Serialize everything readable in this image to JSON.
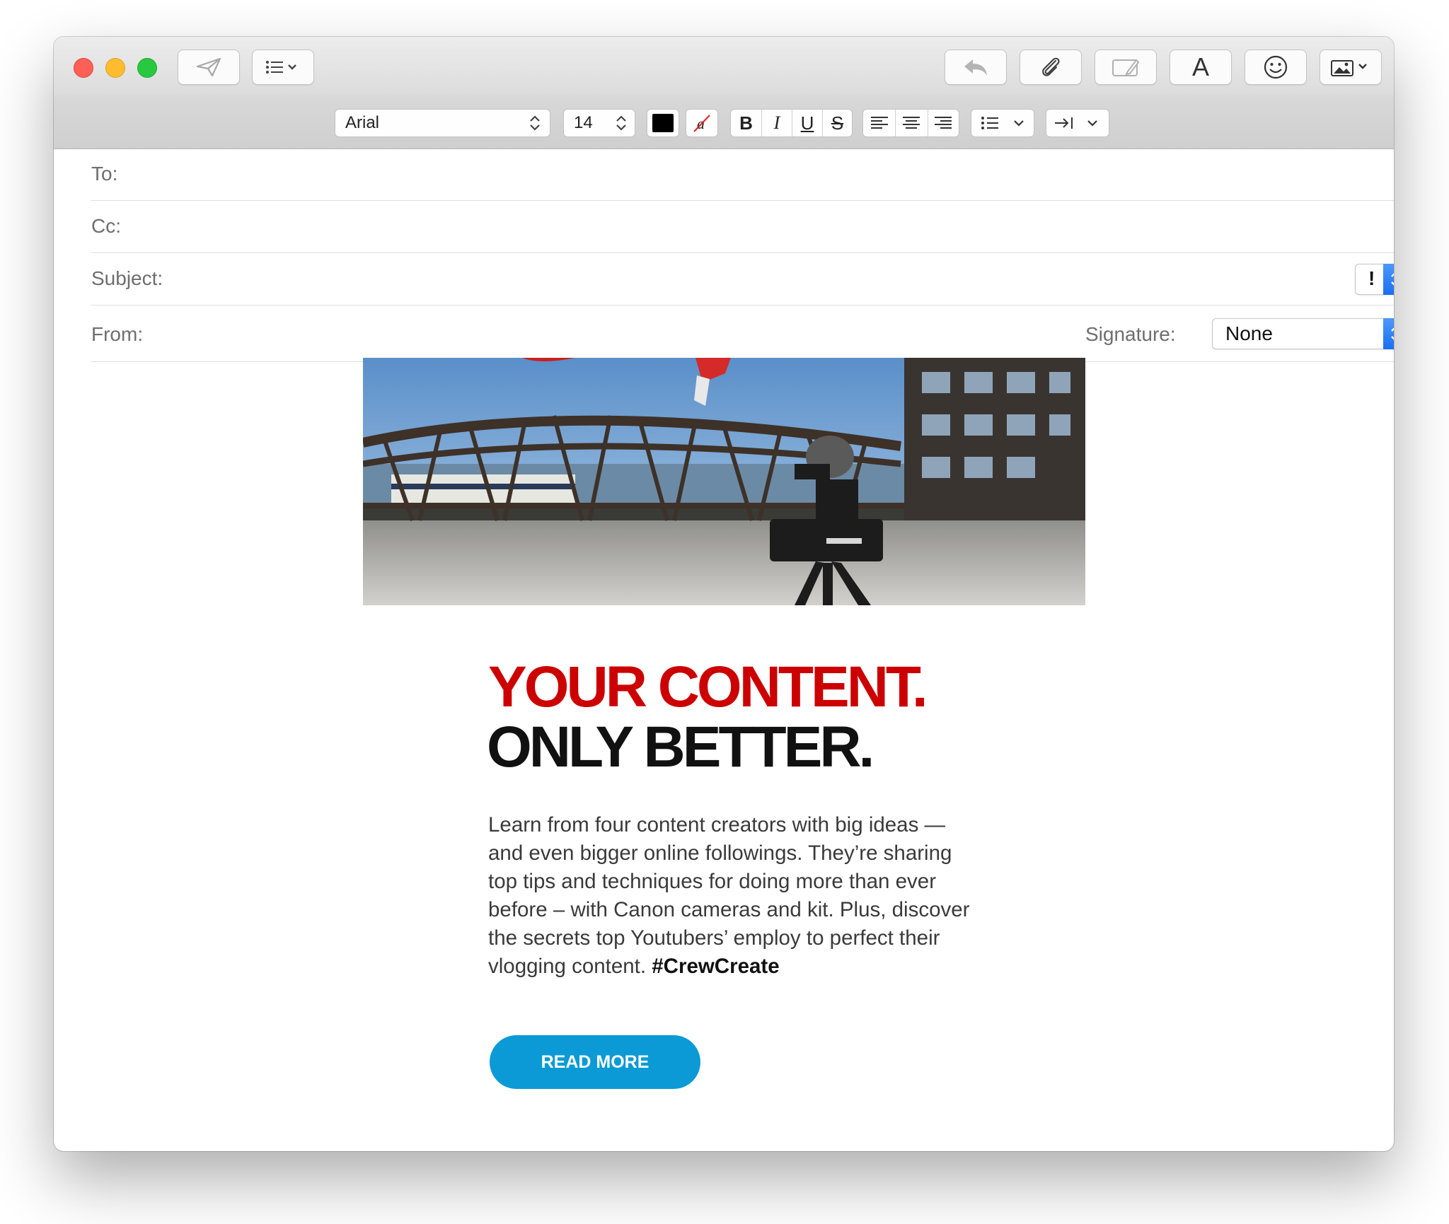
{
  "toolbar": {
    "send_icon": "paper-plane-icon",
    "header_fields_icon": "list-chevron-icon",
    "reply_icon": "reply-arrow-icon",
    "attach_icon": "paperclip-icon",
    "markup_icon": "markup-icon",
    "format_icon": "font-A-icon",
    "emoji_icon": "smiley-icon",
    "photo_icon": "photo-browser-icon",
    "format_letter": "A"
  },
  "format_bar": {
    "font": "Arial",
    "size": "14",
    "text_color": "#000000",
    "bold": "B",
    "italic": "I",
    "underline": "U",
    "strike": "S"
  },
  "header": {
    "to_label": "To:",
    "cc_label": "Cc:",
    "subject_label": "Subject:",
    "from_label": "From:",
    "priority": "!",
    "signature_label": "Signature:",
    "signature_value": "None"
  },
  "message": {
    "headline_line1": "YOUR CONTENT.",
    "headline_line2": "ONLY BETTER.",
    "body_lines": [
      "Learn from four content creators with big ideas —",
      "and even bigger online followings. They’re sharing",
      "top tips and techniques for doing more than ever",
      "before – with Canon cameras and kit. Plus, discover",
      "the secrets top Youtubers’ employ to perfect their",
      "vlogging content."
    ],
    "hashtag": "#CrewCreate",
    "button_label": "READ MORE",
    "accent_red": "#cc0000",
    "button_color": "#0b9ad6"
  }
}
